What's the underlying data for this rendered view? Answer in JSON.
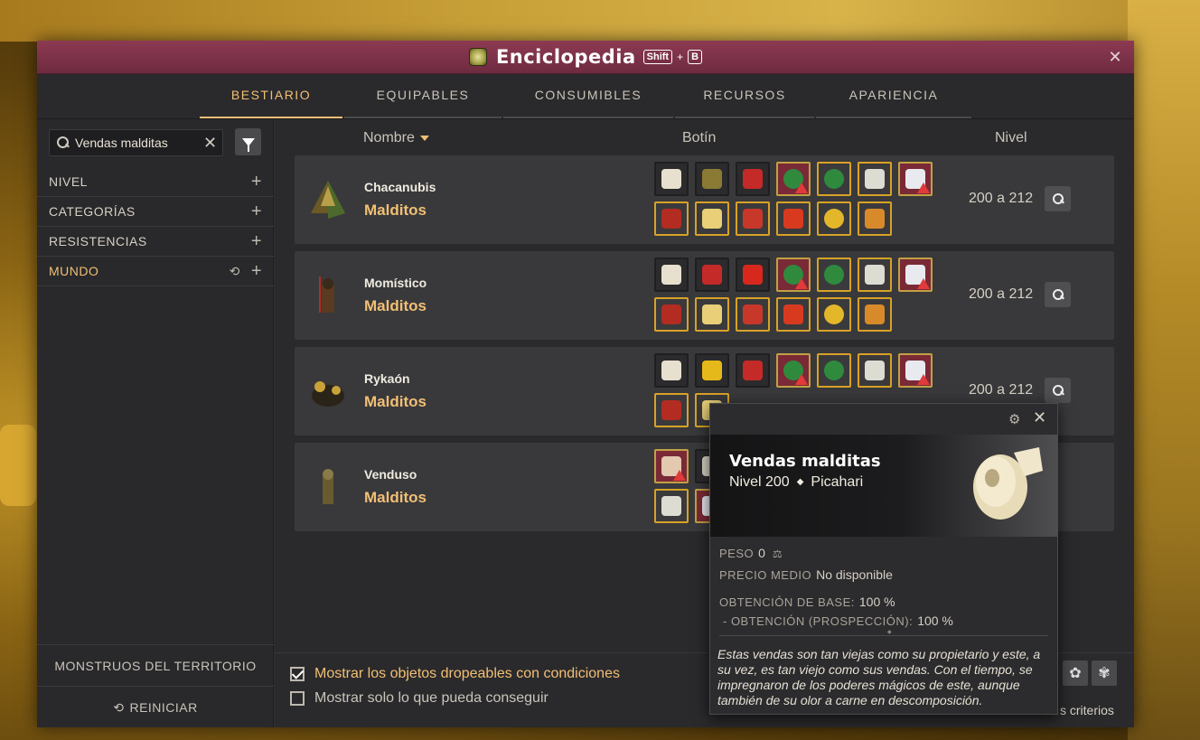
{
  "window": {
    "title": "Enciclopedia",
    "shortcut_key1": "Shift",
    "shortcut_plus": "+",
    "shortcut_key2": "B"
  },
  "tabs": [
    {
      "label": "BESTIARIO",
      "active": true
    },
    {
      "label": "EQUIPABLES",
      "active": false
    },
    {
      "label": "CONSUMIBLES",
      "active": false
    },
    {
      "label": "RECURSOS",
      "active": false
    },
    {
      "label": "APARIENCIA",
      "active": false
    }
  ],
  "sidebar": {
    "search_value": "Vendas malditas",
    "filters": [
      {
        "label": "NIVEL",
        "active": false
      },
      {
        "label": "CATEGORÍAS",
        "active": false
      },
      {
        "label": "RESISTENCIAS",
        "active": false
      },
      {
        "label": "MUNDO",
        "active": true
      }
    ],
    "territory_label": "MONSTRUOS DEL TERRITORIO",
    "reset_label": "REINICIAR"
  },
  "columns": {
    "name": "Nombre",
    "loot": "Botín",
    "level": "Nivel"
  },
  "monsters": [
    {
      "name": "Chacanubis",
      "family": "Malditos",
      "level": "200 a 212"
    },
    {
      "name": "Momístico",
      "family": "Malditos",
      "level": "200 a 212"
    },
    {
      "name": "Rykaón",
      "family": "Malditos",
      "level": "200 a 212"
    },
    {
      "name": "Venduso",
      "family": "Malditos",
      "level": ""
    }
  ],
  "options": {
    "show_conditional": "Mostrar los objetos dropeables con condiciones",
    "show_conditional_checked": true,
    "show_obtainable": "Mostrar solo lo que pueda conseguir",
    "show_obtainable_checked": false,
    "criteria_label": "s criterios"
  },
  "tooltip": {
    "name": "Vendas malditas",
    "level": "Nivel 200",
    "type": "Picahari",
    "weight_key": "PESO",
    "weight_value": "0",
    "price_key": "PRECIO MEDIO",
    "price_value": "No disponible",
    "base_key": "OBTENCIÓN DE BASE:",
    "base_value": "100 %",
    "prosp_key": "- OBTENCIÓN (PROSPECCIÓN):",
    "prosp_value": "100 %",
    "description": "Estas vendas son tan viejas como su propietario y este, a su vez, es tan viejo como sus vendas. Con el tiempo, se impregnaron de los poderes mágicos de este, aunque también de su olor a carne en descomposición."
  },
  "colors": {
    "accent": "#f2bf74",
    "titlebar": "#8c3a52",
    "panel": "#2d2d2f",
    "row": "#39393b",
    "warn": "#e13a3a"
  }
}
